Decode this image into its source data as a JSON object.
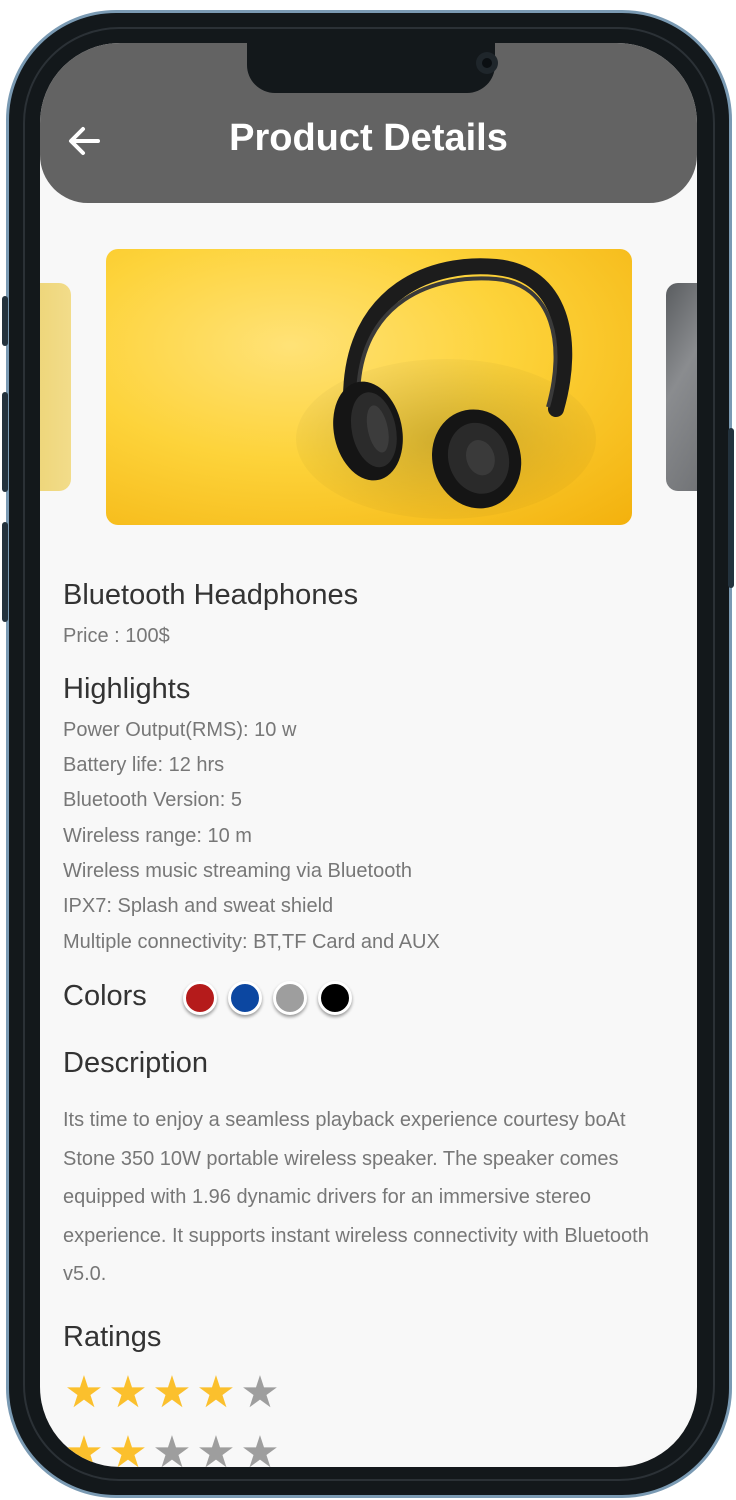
{
  "app_bar": {
    "title": "Product Details",
    "back_icon": "arrow-left-icon"
  },
  "product": {
    "name": "Bluetooth Headphones",
    "price": "Price : 100$"
  },
  "highlights": {
    "heading": "Highlights",
    "items": [
      "Power Output(RMS): 10 w",
      "Battery life: 12 hrs",
      "Bluetooth Version: 5",
      "Wireless range: 10 m",
      "Wireless music streaming via Bluetooth",
      "IPX7: Splash and sweat shield",
      "Multiple connectivity: BT,TF Card and AUX"
    ]
  },
  "colors": {
    "label": "Colors",
    "swatches": [
      "#b51b1b",
      "#0c47a1",
      "#9e9e9e",
      "#000000"
    ]
  },
  "description": {
    "heading": "Description",
    "text": "Its time to enjoy a seamless playback experience courtesy boAt Stone 350 10W portable wireless speaker. The speaker comes equipped with 1.96 dynamic drivers for an immersive stereo experience. It supports instant wireless connectivity with Bluetooth v5.0."
  },
  "ratings": {
    "heading": "Ratings",
    "rows": [
      {
        "filled": 4,
        "total": 5
      },
      {
        "filled": 2,
        "total": 5
      }
    ]
  },
  "theme": {
    "appbar": "#636363",
    "star_filled": "#fbc02d",
    "star_empty": "#9e9e9e"
  }
}
